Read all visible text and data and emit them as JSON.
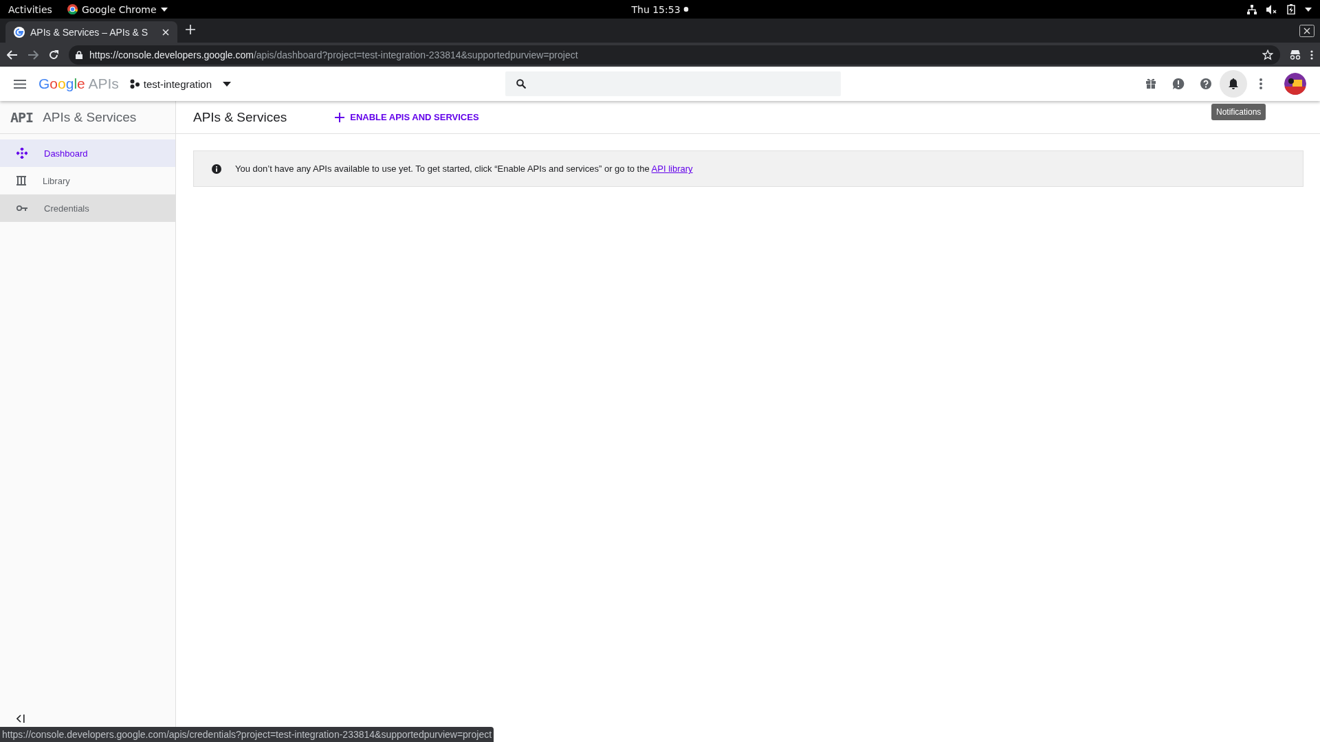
{
  "system_bar": {
    "activities": "Activities",
    "app_name": "Google Chrome",
    "clock": "Thu 15:53"
  },
  "browser": {
    "tab": {
      "title": "APIs & Services – APIs & S",
      "selected": true
    },
    "url_host": "https://console.developers.google.com",
    "url_path": "/apis/dashboard?project=test-integration-233814&supportedpurview=project"
  },
  "header": {
    "logo_word": "Google",
    "logo_suffix": "APIs",
    "project": "test-integration",
    "tooltip": "Notifications"
  },
  "sidebar": {
    "badge": "API",
    "title": "APIs & Services",
    "items": [
      {
        "label": "Dashboard",
        "kind": "dashboard",
        "selected": true,
        "hovered": false
      },
      {
        "label": "Library",
        "kind": "library",
        "selected": false,
        "hovered": false
      },
      {
        "label": "Credentials",
        "kind": "credentials",
        "selected": false,
        "hovered": true
      }
    ]
  },
  "main": {
    "title": "APIs & Services",
    "enable_button": "ENABLE APIS AND SERVICES",
    "notice": "You don’t have any APIs available to use yet. To get started, click “Enable APIs and services” or go to the",
    "notice_link": "API library"
  },
  "status_url": "https://console.developers.google.com/apis/credentials?project=test-integration-233814&supportedpurview=project"
}
